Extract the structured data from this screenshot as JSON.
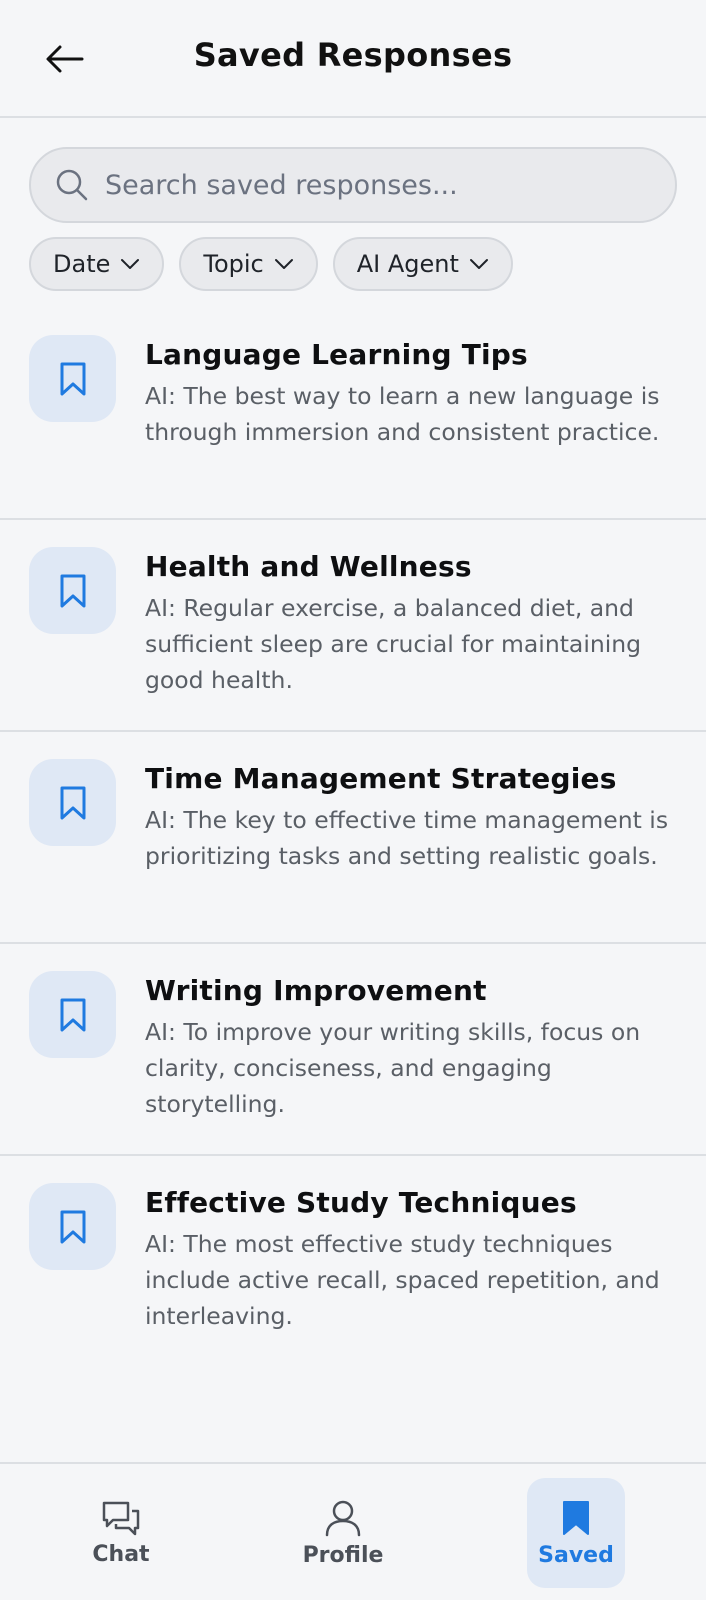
{
  "header": {
    "title": "Saved Responses",
    "back_icon": "arrow-left-icon"
  },
  "search": {
    "placeholder": "Search saved responses...",
    "value": ""
  },
  "filters": [
    {
      "label": "Date"
    },
    {
      "label": "Topic"
    },
    {
      "label": "AI Agent"
    }
  ],
  "items": [
    {
      "title": "Language Learning Tips",
      "body": "AI: The best way to learn a new language is through immersion and consistent practice."
    },
    {
      "title": "Health and Wellness",
      "body": "AI: Regular exercise, a balanced diet, and sufficient sleep are crucial for maintaining good health."
    },
    {
      "title": "Time Management Strategies",
      "body": "AI: The key to effective time management is prioritizing tasks and setting realistic goals."
    },
    {
      "title": "Writing Improvement",
      "body": "AI: To improve your writing skills, focus on clarity, conciseness, and engaging storytelling."
    },
    {
      "title": "Effective Study Techniques",
      "body": "AI: The most effective study techniques include active recall, spaced repetition, and interleaving."
    }
  ],
  "nav": {
    "chat": {
      "label": "Chat"
    },
    "profile": {
      "label": "Profile"
    },
    "saved": {
      "label": "Saved",
      "active": true
    }
  },
  "colors": {
    "accent": "#1f7ae0",
    "badge_bg": "#dfe8f5",
    "background": "#f5f6f8"
  }
}
